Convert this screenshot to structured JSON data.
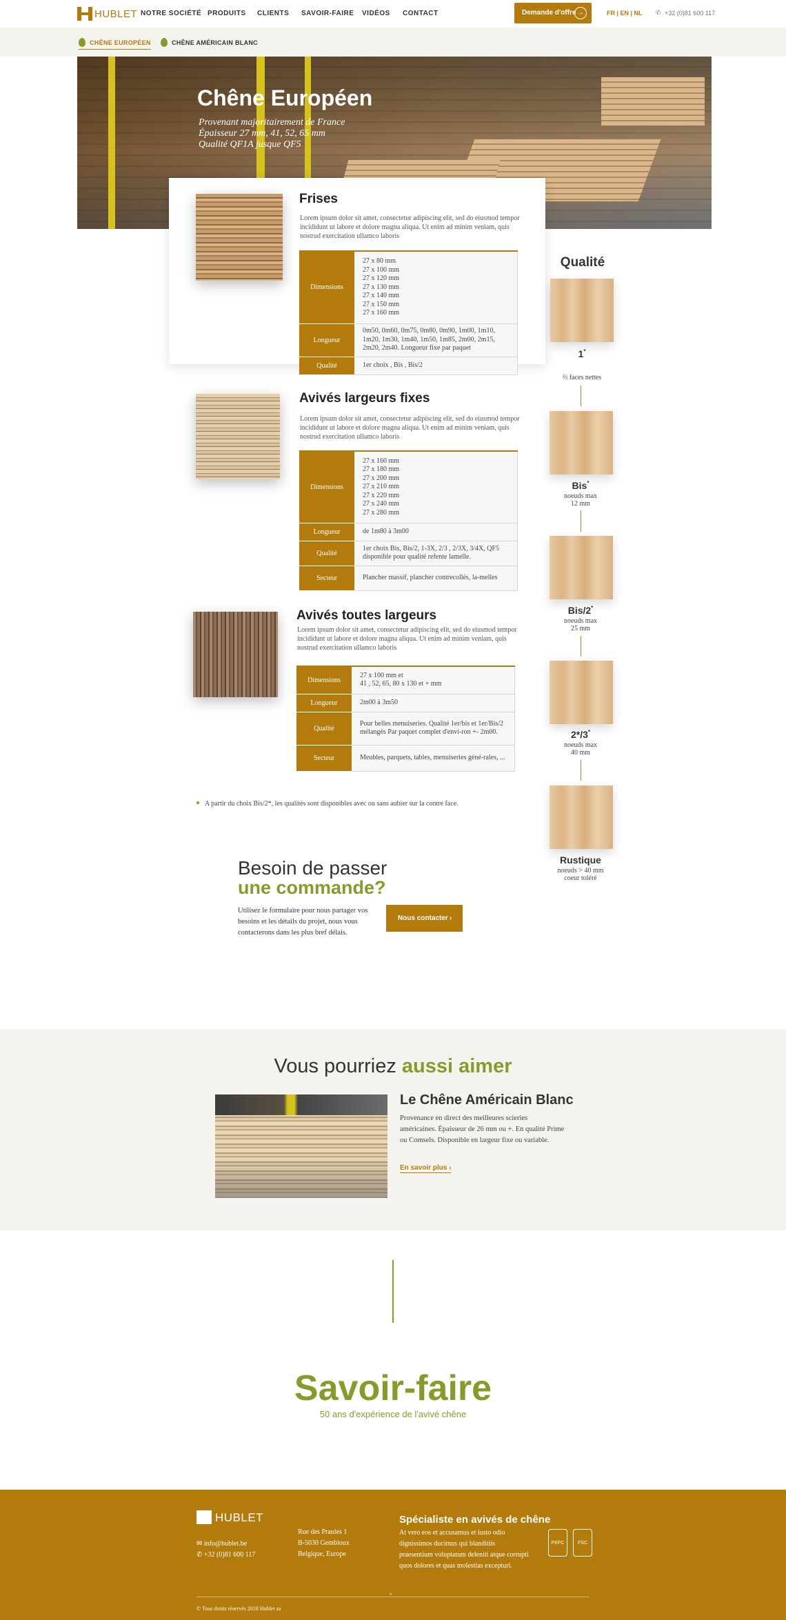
{
  "nav": {
    "logo": "HUBLET",
    "items": [
      "NOTRE SOCIÉTÉ",
      "PRODUITS",
      "CLIENTS",
      "SAVOIR-FAIRE",
      "VIDÉOS",
      "CONTACT"
    ],
    "cta_label": "Demande d'offre",
    "languages": "FR | EN | NL",
    "phone": "+32 (0)81 600 117"
  },
  "subnav": {
    "items": [
      "CHÊNE EUROPÉEN",
      "CHÊNE AMÉRICAIN BLANC"
    ],
    "active": "CHÊNE EUROPÉEN"
  },
  "hero": {
    "title": "Chêne Européen",
    "lines": [
      "Provenant majoritairement de France",
      "Épaisseur 27 mm, 41, 52, 65 mm",
      "Qualité QF1A jusque QF5"
    ]
  },
  "products": [
    {
      "title": "Frises",
      "desc": "Lorem ipsum dolor sit amet, consectetur adipiscing elit, sed do eiusmod tempor incididunt ut labore et dolore magna aliqua. Ut enim ad minim veniam, quis nostrud exercitation ullamco laboris",
      "rows": [
        {
          "label": "Dimensions",
          "value": [
            "27 x 80 mm",
            "27 x 100 mm",
            "27 x 120 mm",
            "27 x 130 mm",
            "27 x 140 mm",
            "27 x 150 mm",
            "27 x 160 mm"
          ]
        },
        {
          "label": "Longueur",
          "value": [
            "0m50, 0m60, 0m75, 0m80, 0m90, 1m00, 1m10, 1m20, 1m30, 1m40, 1m50, 1m85, 2m00, 2m15, 2m20, 2m40. Longueur fixe par paquet"
          ]
        },
        {
          "label": "Qualité",
          "value": [
            "1er choix , Bis , Bis/2"
          ]
        }
      ]
    },
    {
      "title": "Avivés largeurs fixes",
      "desc": "Lorem ipsum dolor sit amet, consectetur adipiscing elit, sed do eiusmod tempor incididunt ut labore et dolore magna aliqua. Ut enim ad minim veniam, quis nostrud exercitation ullamco laboris",
      "rows": [
        {
          "label": "Dimensions",
          "value": [
            "27 x 160 mm",
            "27 x 180 mm",
            "27 x 200 mm",
            "27 x 210 mm",
            "27 x 220 mm",
            "27 x 240 mm",
            "27 x 280 mm"
          ]
        },
        {
          "label": "Longueur",
          "value": [
            "de 1m80 à 3m00"
          ]
        },
        {
          "label": "Qualité",
          "value": [
            "1er choix Bis, Bis/2, 1-3X, 2/3 , 2/3X, 3/4X, QF5 disponible pour qualité refente lamelle."
          ]
        },
        {
          "label": "Secteur",
          "value": [
            "Plancher massif, plancher contrecollés, la-melles"
          ]
        }
      ]
    },
    {
      "title": "Avivés toutes largeurs",
      "desc": "Lorem ipsum dolor sit amet, consectetur adipiscing elit, sed do eiusmod tempor incididunt ut labore et dolore magna aliqua. Ut enim ad minim veniam, quis nostrud exercitation ullamco laboris",
      "rows": [
        {
          "label": "Dimensions",
          "value": [
            "27 x 100 mm et",
            "41 , 52, 65, 80 x 130 et + mm"
          ]
        },
        {
          "label": "Longueur",
          "value": [
            "2m00 à 3m50"
          ]
        },
        {
          "label": "Qualité",
          "value": [
            "Pour belles menuiseries. Qualité 1er/bis et 1er/Bis/2 mélangés Par paquet complet d'envi-ron +- 2m00."
          ]
        },
        {
          "label": "Secteur",
          "value": [
            "Meubles, parquets, tables, menuiseries géné-rales, ..."
          ]
        }
      ]
    }
  ],
  "quality": {
    "title": "Qualité",
    "items": [
      {
        "name": "1",
        "star": "*",
        "sub": [
          "⅔ faces nettes"
        ]
      },
      {
        "name": "Bis",
        "star": "*",
        "sub": [
          "noeuds max",
          "12 mm"
        ]
      },
      {
        "name": "Bis/2",
        "star": "*",
        "sub": [
          "noeuds max",
          "25 mm"
        ]
      },
      {
        "name": "2*/3",
        "star": "*",
        "sub": [
          "noeuds max",
          "40 mm"
        ]
      },
      {
        "name": "Rustique",
        "star": "",
        "sub": [
          "noeuds > 40 mm",
          "coeur toléré"
        ]
      }
    ]
  },
  "note": "A partir du choix Bis/2*, les qualités sont disponibles avec ou sans aubier sur la contre face.",
  "order": {
    "title_1": "Besoin de passer",
    "title_2": "une commande?",
    "text": "Utilisez le formulaire pour nous partager vos besoins et les détails du projet, nous vous contacterons dans les plus bref délais.",
    "button": "Nous contacter"
  },
  "related": {
    "title_1": "Vous pourriez ",
    "title_2": "aussi aimer",
    "product_title": "Le Chêne Américain Blanc",
    "product_desc": "Provenance en direct des meilleures scieries américaines. Épaisseur de 26 mm ou +. En qualité Prime ou Comsels. Disponible en largeur fixe ou variable.",
    "link": "En savoir plus"
  },
  "savoir_faire": {
    "title": "Savoir-faire",
    "subtitle": "50 ans d'expérience de l'avivé chêne"
  },
  "footer": {
    "logo": "HUBLET",
    "email": "info@hublet.be",
    "phone": "+32 (0)81 600 117",
    "address": [
      "Rue des Praules 1",
      "B-5030 Gembloux",
      "Belgique, Europe"
    ],
    "heading": "Spécialiste en avivés de chêne",
    "desc": "At vero eos et accusamus et iusto odio dignissimos ducimus qui blanditiis praesentium voluptatum deleniti atque corrupti quos dolores et quas molestias excepturi.",
    "certs": [
      "PEFC",
      "FSC"
    ],
    "copyright": "© Tous droits réservés 2018 Hublet sa"
  },
  "colors": {
    "accent": "#b37b0c",
    "green": "#8a9a2a",
    "light_bg": "#f5f3ee"
  }
}
